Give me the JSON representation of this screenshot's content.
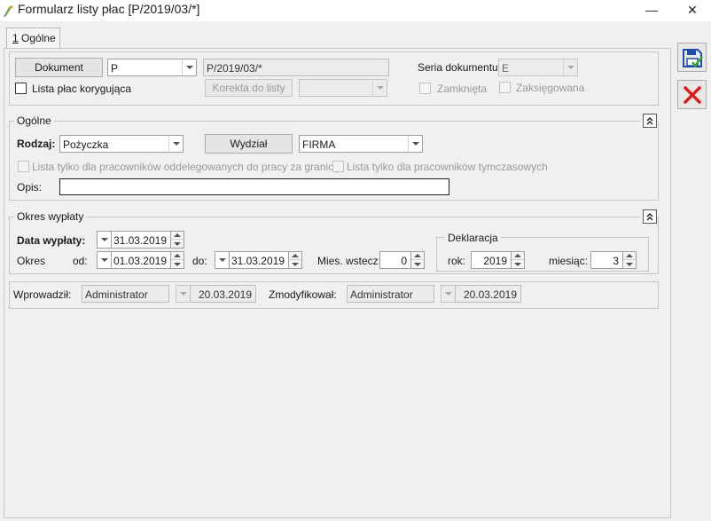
{
  "window": {
    "title": "Formularz listy płac [P/2019/03/*]",
    "minimize_label": "—",
    "close_label": "✕"
  },
  "tabs": [
    {
      "label_prefix": "1",
      "label_rest": " Ogólne"
    }
  ],
  "document": {
    "dokument_button": "Dokument",
    "dokument_type": "P",
    "document_number": "P/2019/03/*",
    "seria_label": "Seria dokumentu:",
    "seria_value": "E",
    "lista_korygujaca_label": "Lista płac korygująca",
    "korekta_button": "Korekta do listy",
    "korekta_value": "",
    "zamknieta_label": "Zamknięta",
    "zaksiegowana_label": "Zaksięgowana"
  },
  "ogolne": {
    "section_title": "Ogólne",
    "rodzaj_label": "Rodzaj:",
    "rodzaj_value": "Pożyczka",
    "wydzial_button": "Wydział",
    "wydzial_value": "FIRMA",
    "oddelegowani_label": "Lista tylko dla pracowników oddelegowanych do pracy za granicę",
    "tymczasowi_label": "Lista tylko dla pracowników tymczasowych",
    "opis_label": "Opis:",
    "opis_value": ""
  },
  "okres": {
    "section_title": "Okres wypłaty",
    "data_wyplaty_label": "Data wypłaty:",
    "data_wyplaty_value": "31.03.2019",
    "okres_label": "Okres",
    "od_label": "od:",
    "od_value": "01.03.2019",
    "do_label": "do:",
    "do_value": "31.03.2019",
    "mies_wstecz_label": "Mies. wstecz:",
    "mies_wstecz_value": "0",
    "deklaracja_title": "Deklaracja",
    "rok_label": "rok:",
    "rok_value": "2019",
    "miesiac_label": "miesiąc:",
    "miesiac_value": "3"
  },
  "audit": {
    "wprowadzil_label": "Wprowadził:",
    "wprowadzil_user": "Administrator",
    "wprowadzil_date": "20.03.2019",
    "zmodyfikowal_label": "Zmodyfikował:",
    "zmodyfikowal_user": "Administrator",
    "zmodyfikowal_date": "20.03.2019"
  },
  "side_buttons": {
    "save_icon": "save-disk-icon",
    "cancel_icon": "red-x-icon",
    "save_color": "#1f4fa8",
    "cancel_color": "#d81e1e"
  }
}
